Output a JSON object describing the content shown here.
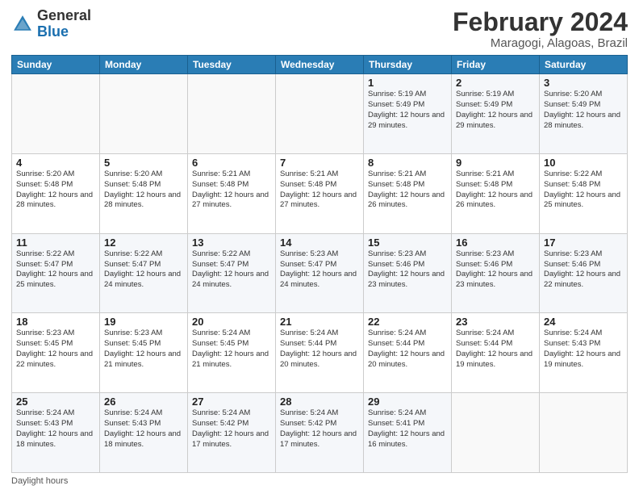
{
  "logo": {
    "general": "General",
    "blue": "Blue"
  },
  "header": {
    "month": "February 2024",
    "location": "Maragogi, Alagoas, Brazil"
  },
  "days_of_week": [
    "Sunday",
    "Monday",
    "Tuesday",
    "Wednesday",
    "Thursday",
    "Friday",
    "Saturday"
  ],
  "weeks": [
    [
      {
        "day": "",
        "info": ""
      },
      {
        "day": "",
        "info": ""
      },
      {
        "day": "",
        "info": ""
      },
      {
        "day": "",
        "info": ""
      },
      {
        "day": "1",
        "info": "Sunrise: 5:19 AM\nSunset: 5:49 PM\nDaylight: 12 hours and 29 minutes."
      },
      {
        "day": "2",
        "info": "Sunrise: 5:19 AM\nSunset: 5:49 PM\nDaylight: 12 hours and 29 minutes."
      },
      {
        "day": "3",
        "info": "Sunrise: 5:20 AM\nSunset: 5:49 PM\nDaylight: 12 hours and 28 minutes."
      }
    ],
    [
      {
        "day": "4",
        "info": "Sunrise: 5:20 AM\nSunset: 5:48 PM\nDaylight: 12 hours and 28 minutes."
      },
      {
        "day": "5",
        "info": "Sunrise: 5:20 AM\nSunset: 5:48 PM\nDaylight: 12 hours and 28 minutes."
      },
      {
        "day": "6",
        "info": "Sunrise: 5:21 AM\nSunset: 5:48 PM\nDaylight: 12 hours and 27 minutes."
      },
      {
        "day": "7",
        "info": "Sunrise: 5:21 AM\nSunset: 5:48 PM\nDaylight: 12 hours and 27 minutes."
      },
      {
        "day": "8",
        "info": "Sunrise: 5:21 AM\nSunset: 5:48 PM\nDaylight: 12 hours and 26 minutes."
      },
      {
        "day": "9",
        "info": "Sunrise: 5:21 AM\nSunset: 5:48 PM\nDaylight: 12 hours and 26 minutes."
      },
      {
        "day": "10",
        "info": "Sunrise: 5:22 AM\nSunset: 5:48 PM\nDaylight: 12 hours and 25 minutes."
      }
    ],
    [
      {
        "day": "11",
        "info": "Sunrise: 5:22 AM\nSunset: 5:47 PM\nDaylight: 12 hours and 25 minutes."
      },
      {
        "day": "12",
        "info": "Sunrise: 5:22 AM\nSunset: 5:47 PM\nDaylight: 12 hours and 24 minutes."
      },
      {
        "day": "13",
        "info": "Sunrise: 5:22 AM\nSunset: 5:47 PM\nDaylight: 12 hours and 24 minutes."
      },
      {
        "day": "14",
        "info": "Sunrise: 5:23 AM\nSunset: 5:47 PM\nDaylight: 12 hours and 24 minutes."
      },
      {
        "day": "15",
        "info": "Sunrise: 5:23 AM\nSunset: 5:46 PM\nDaylight: 12 hours and 23 minutes."
      },
      {
        "day": "16",
        "info": "Sunrise: 5:23 AM\nSunset: 5:46 PM\nDaylight: 12 hours and 23 minutes."
      },
      {
        "day": "17",
        "info": "Sunrise: 5:23 AM\nSunset: 5:46 PM\nDaylight: 12 hours and 22 minutes."
      }
    ],
    [
      {
        "day": "18",
        "info": "Sunrise: 5:23 AM\nSunset: 5:45 PM\nDaylight: 12 hours and 22 minutes."
      },
      {
        "day": "19",
        "info": "Sunrise: 5:23 AM\nSunset: 5:45 PM\nDaylight: 12 hours and 21 minutes."
      },
      {
        "day": "20",
        "info": "Sunrise: 5:24 AM\nSunset: 5:45 PM\nDaylight: 12 hours and 21 minutes."
      },
      {
        "day": "21",
        "info": "Sunrise: 5:24 AM\nSunset: 5:44 PM\nDaylight: 12 hours and 20 minutes."
      },
      {
        "day": "22",
        "info": "Sunrise: 5:24 AM\nSunset: 5:44 PM\nDaylight: 12 hours and 20 minutes."
      },
      {
        "day": "23",
        "info": "Sunrise: 5:24 AM\nSunset: 5:44 PM\nDaylight: 12 hours and 19 minutes."
      },
      {
        "day": "24",
        "info": "Sunrise: 5:24 AM\nSunset: 5:43 PM\nDaylight: 12 hours and 19 minutes."
      }
    ],
    [
      {
        "day": "25",
        "info": "Sunrise: 5:24 AM\nSunset: 5:43 PM\nDaylight: 12 hours and 18 minutes."
      },
      {
        "day": "26",
        "info": "Sunrise: 5:24 AM\nSunset: 5:43 PM\nDaylight: 12 hours and 18 minutes."
      },
      {
        "day": "27",
        "info": "Sunrise: 5:24 AM\nSunset: 5:42 PM\nDaylight: 12 hours and 17 minutes."
      },
      {
        "day": "28",
        "info": "Sunrise: 5:24 AM\nSunset: 5:42 PM\nDaylight: 12 hours and 17 minutes."
      },
      {
        "day": "29",
        "info": "Sunrise: 5:24 AM\nSunset: 5:41 PM\nDaylight: 12 hours and 16 minutes."
      },
      {
        "day": "",
        "info": ""
      },
      {
        "day": "",
        "info": ""
      }
    ]
  ],
  "footer": {
    "note": "Daylight hours"
  }
}
